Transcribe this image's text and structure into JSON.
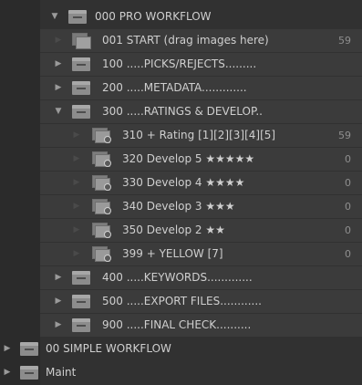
{
  "tree": {
    "rows": [
      {
        "id": "000-pro-workflow",
        "label": "000 PRO WORKFLOW",
        "twisty": "▼",
        "icon": "collection-set-icon",
        "count": ""
      },
      {
        "id": "001-start",
        "label": "001 START (drag images here)",
        "twisty": "▶",
        "icon": "collection-icon",
        "count": "59"
      },
      {
        "id": "100-picks",
        "label": "100 .....PICKS/REJECTS.........",
        "twisty": "▶",
        "icon": "collection-set-icon",
        "count": ""
      },
      {
        "id": "200-metadata",
        "label": "200 .....METADATA.............",
        "twisty": "▶",
        "icon": "collection-set-icon",
        "count": ""
      },
      {
        "id": "300-ratings",
        "label": "300 .....RATINGS & DEVELOP..",
        "twisty": "▼",
        "icon": "collection-set-icon",
        "count": ""
      },
      {
        "id": "310-rating",
        "label": "310 + Rating [1][2][3][4][5]",
        "twisty": "▶",
        "icon": "smart-collection-icon",
        "count": "59"
      },
      {
        "id": "320-develop-5",
        "label": "320 Develop 5 ★★★★★",
        "twisty": "▶",
        "icon": "smart-collection-icon",
        "count": "0"
      },
      {
        "id": "330-develop-4",
        "label": "330  Develop 4 ★★★★",
        "twisty": "▶",
        "icon": "smart-collection-icon",
        "count": "0"
      },
      {
        "id": "340-develop-3",
        "label": "340   Develop 3 ★★★",
        "twisty": "▶",
        "icon": "smart-collection-icon",
        "count": "0"
      },
      {
        "id": "350-develop-2",
        "label": "350    Develop 2 ★★",
        "twisty": "▶",
        "icon": "smart-collection-icon",
        "count": "0"
      },
      {
        "id": "399-yellow",
        "label": "399    + YELLOW [7]",
        "twisty": "▶",
        "icon": "smart-collection-icon",
        "count": "0"
      },
      {
        "id": "400-keywords",
        "label": "400 .....KEYWORDS.............",
        "twisty": "▶",
        "icon": "collection-set-icon",
        "count": ""
      },
      {
        "id": "500-export",
        "label": "500 .....EXPORT FILES............",
        "twisty": "▶",
        "icon": "collection-set-icon",
        "count": ""
      },
      {
        "id": "900-final",
        "label": "900 .....FINAL CHECK..........",
        "twisty": "▶",
        "icon": "collection-set-icon",
        "count": ""
      },
      {
        "id": "00-simple-workflow",
        "label": "00 SIMPLE WORKFLOW",
        "twisty": "▶",
        "icon": "collection-set-icon",
        "count": ""
      },
      {
        "id": "maint",
        "label": "Maint",
        "twisty": "▶",
        "icon": "collection-set-icon",
        "count": ""
      }
    ]
  }
}
